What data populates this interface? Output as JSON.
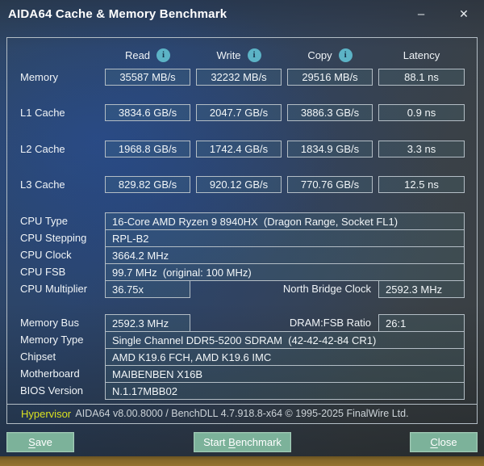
{
  "window": {
    "title": "AIDA64 Cache & Memory Benchmark",
    "minimize_glyph": "–",
    "close_glyph": "✕"
  },
  "benchmark": {
    "columns": [
      "Read",
      "Write",
      "Copy",
      "Latency"
    ],
    "info_glyph": "i",
    "rows": [
      {
        "label": "Memory",
        "read": "35587 MB/s",
        "write": "32232 MB/s",
        "copy": "29516 MB/s",
        "latency": "88.1 ns"
      },
      {
        "label": "L1 Cache",
        "read": "3834.6 GB/s",
        "write": "2047.7 GB/s",
        "copy": "3886.3 GB/s",
        "latency": "0.9 ns"
      },
      {
        "label": "L2 Cache",
        "read": "1968.8 GB/s",
        "write": "1742.4 GB/s",
        "copy": "1834.9 GB/s",
        "latency": "3.3 ns"
      },
      {
        "label": "L3 Cache",
        "read": "829.82 GB/s",
        "write": "920.12 GB/s",
        "copy": "770.76 GB/s",
        "latency": "12.5 ns"
      }
    ]
  },
  "cpu_info": {
    "rows": [
      {
        "label": "CPU Type",
        "value": "16-Core AMD Ryzen 9 8940HX  (Dragon Range, Socket FL1)"
      },
      {
        "label": "CPU Stepping",
        "value": "RPL-B2"
      },
      {
        "label": "CPU Clock",
        "value": "3664.2 MHz"
      },
      {
        "label": "CPU FSB",
        "value": "99.7 MHz  (original: 100 MHz)"
      },
      {
        "label": "CPU Multiplier",
        "value": "36.75x",
        "extra_label": "North Bridge Clock",
        "extra_value": "2592.3 MHz"
      }
    ]
  },
  "memory_info": {
    "rows": [
      {
        "label": "Memory Bus",
        "value": "2592.3 MHz",
        "extra_label": "DRAM:FSB Ratio",
        "extra_value": "26:1"
      },
      {
        "label": "Memory Type",
        "value": "Single Channel DDR5-5200 SDRAM  (42-42-42-84 CR1)"
      },
      {
        "label": "Chipset",
        "value": "AMD K19.6 FCH, AMD K19.6 IMC"
      },
      {
        "label": "Motherboard",
        "value": "MAIBENBEN X16B"
      },
      {
        "label": "BIOS Version",
        "value": "N.1.17MBB02"
      }
    ]
  },
  "footer": {
    "hypervisor_label": "Hypervisor",
    "copyright": "AIDA64 v8.00.8000 / BenchDLL 4.7.918.8-x64 © 1995-2025 FinalWire Ltd."
  },
  "buttons": {
    "save": {
      "pre": "",
      "key": "S",
      "rest": "ave"
    },
    "start": {
      "pre": "Start ",
      "key": "B",
      "rest": "enchmark"
    },
    "close": {
      "pre": "",
      "key": "C",
      "rest": "lose"
    }
  },
  "colors": {
    "button_green": "#7cb29a",
    "info_icon_teal": "#5cb3c6",
    "hypervisor_yellow": "#d9e021",
    "box_border_gray": "#b3bdc5",
    "bottom_strip_gold": "#95732f",
    "background_blue": "#2e4668"
  }
}
